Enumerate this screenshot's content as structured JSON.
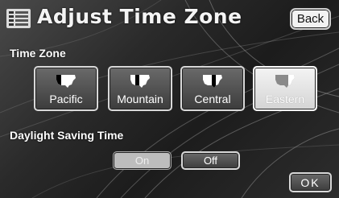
{
  "header": {
    "title": "Adjust Time Zone",
    "menu_icon": "list-icon",
    "back_label": "Back"
  },
  "time_zone": {
    "label": "Time Zone",
    "options": [
      {
        "label": "Pacific",
        "icon": "us-map-pacific-icon"
      },
      {
        "label": "Mountain",
        "icon": "us-map-mountain-icon"
      },
      {
        "label": "Central",
        "icon": "us-map-central-icon"
      },
      {
        "label": "Eastern",
        "icon": "us-map-eastern-icon"
      }
    ],
    "selected": "Eastern"
  },
  "daylight_saving": {
    "label": "Daylight Saving Time",
    "on_label": "On",
    "off_label": "Off",
    "selected": "On"
  },
  "footer": {
    "ok_label": "OK"
  },
  "colors": {
    "button_face": "#4d4d4d",
    "button_border": "#d8d8d8",
    "selected_face": "#e8e8e8",
    "text": "#ffffff"
  }
}
